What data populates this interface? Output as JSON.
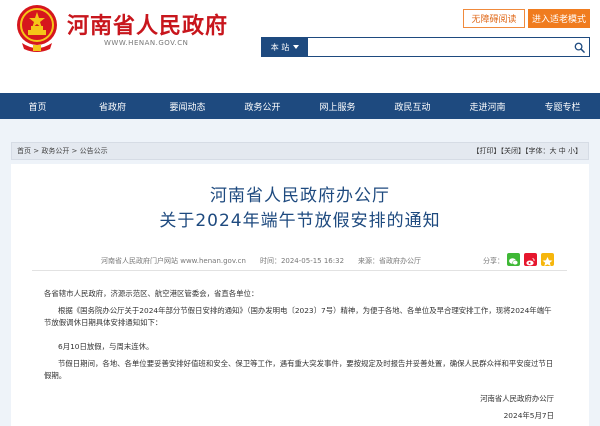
{
  "header": {
    "site_title": "河南省人民政府",
    "site_url": "WWW.HENAN.GOV.CN",
    "accessibility_label": "无障碍阅读",
    "elder_mode_label": "进入适老模式",
    "search_scope": "本 站",
    "search_value": ""
  },
  "nav": {
    "items": [
      "首页",
      "省政府",
      "要闻动态",
      "政务公开",
      "网上服务",
      "政民互动",
      "走进河南",
      "专题专栏"
    ]
  },
  "breadcrumb": {
    "home": "首页",
    "sep1": " > ",
    "section": "政务公开",
    "sep2": " > ",
    "current": "公告公示"
  },
  "tools": {
    "print": "【打印】",
    "close": "【关闭】",
    "font_prefix": "【字体：",
    "font_large": "大",
    "font_medium": "中",
    "font_small": "小",
    "font_suffix": "】"
  },
  "article": {
    "title_line1": "河南省人民政府办公厅",
    "title_line2": "关于2024年端午节放假安排的通知",
    "meta": "河南省人民政府门户网站 www.henan.gov.cn　　时间：2024-05-15 16:32　　来源：省政府办公厅",
    "share_label": "分享：",
    "para1": "各省辖市人民政府，济源示范区、航空港区管委会，省直各单位：",
    "para2": "根据《国务院办公厅关于2024年部分节假日安排的通知》（国办发明电〔2023〕7号）精神，为便于各地、各单位及早合理安排工作，现将2024年端午节放假调休日期具体安排通知如下：",
    "para3": "6月10日放假，与周末连休。",
    "para4": "节假日期间，各地、各单位要妥善安排好值班和安全、保卫等工作，遇有重大突发事件，要按规定及时报告并妥善处置，确保人民群众祥和平安度过节日假期。",
    "sign_org": "河南省人民政府办公厅",
    "sign_date": "2024年5月7日"
  },
  "colors": {
    "brand_red": "#c8161d",
    "nav_blue": "#1e4a7f",
    "accent_orange": "#f07c1f"
  }
}
